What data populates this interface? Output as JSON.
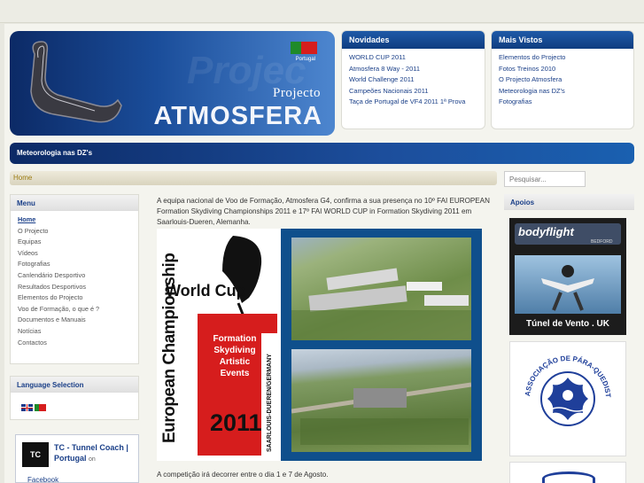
{
  "header": {
    "banner_project_label": "Projecto",
    "banner_brand": "ATMOSFERA",
    "banner_ghost": "Projec",
    "banner_flag_label": "Portugal"
  },
  "novidades": {
    "title": "Novidades",
    "items": [
      "WORLD CUP 2011",
      "Atmosfera 8 Way - 2011",
      "World Challenge 2011",
      "Campeões Nacionais 2011",
      "Taça de Portugal de VF4 2011 1ª Prova"
    ]
  },
  "mais_vistos": {
    "title": "Mais Vistos",
    "items": [
      "Elementos do Projecto",
      "Fotos Treinos 2010",
      "O Projecto Atmosfera",
      "Meteorologia nas DZ's",
      "Fotografias"
    ]
  },
  "bluebar": {
    "label": "Meteorologia nas DZ's"
  },
  "breadcrumb": {
    "home": "Home"
  },
  "search": {
    "placeholder": "Pesquisar..."
  },
  "menu": {
    "title": "Menu",
    "items": [
      "Home",
      "O Projecto",
      "Equipas",
      "Vídeos",
      "Fotografias",
      "Canlendário Desportivo",
      "Resultados Desportivos",
      "Elementos do Projecto",
      "Voo de Formação, o que é ?",
      "Documentos e Manuais",
      "Notícias",
      "Contactos"
    ]
  },
  "language": {
    "title": "Language Selection"
  },
  "facebook": {
    "name": "TC - Tunnel Coach | Portugal",
    "suffix": "on",
    "network": "Facebook",
    "logo": "TC"
  },
  "article": {
    "intro": "A equipa nacional de Voo de Formação, Atmosfera G4, confirma a sua presença  no 10º FAI EUROPEAN Formation Skydiving Championships 2011 e 17º FAI WORLD CUP in Formation Skydiving 2011 em Saarlouis-Dueren, Alemanha.",
    "outro": "A competição irá decorrer entre o dia 1 e 7 de Agosto.",
    "poster": {
      "title": "World Cup",
      "vertical": "European Championship",
      "events": [
        "Formation",
        "Skydiving",
        "Artistic Events"
      ],
      "location": "SAARLOUIS-DUEREN/GERMANY",
      "year": "2011"
    }
  },
  "apoios": {
    "title": "Apoios",
    "bodyflight": "bodyflight",
    "bodyflight_sub": "BEDFORD",
    "tunnel": "Túnel de Vento . UK",
    "association": "ASSOCIAÇÃO DE PÁRA-QUEDISTAS TEJO NORTE"
  },
  "colors": {
    "primary": "#0f3d80",
    "accent": "#d61d1d",
    "poster_red": "#d61d1d"
  }
}
